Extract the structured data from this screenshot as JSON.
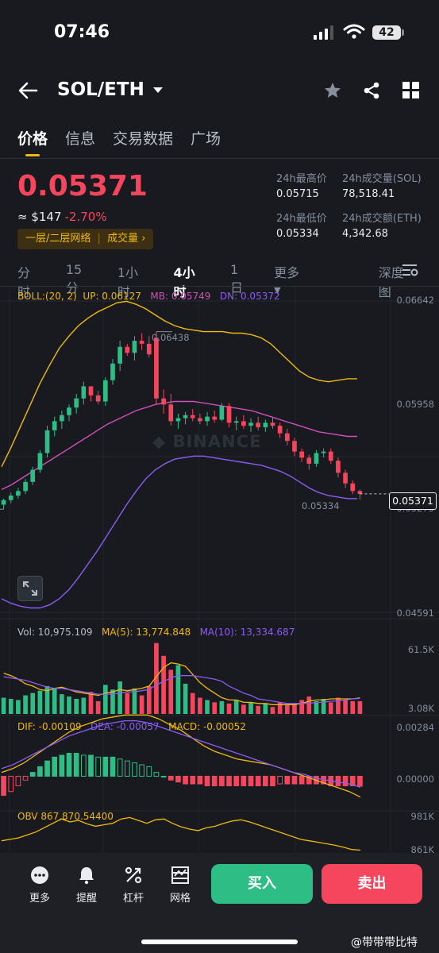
{
  "status_bar": {
    "time": "07:46",
    "battery": "42"
  },
  "header": {
    "pair": "SOL/ETH"
  },
  "tabs": [
    {
      "label": "价格",
      "active": true
    },
    {
      "label": "信息",
      "active": false
    },
    {
      "label": "交易数据",
      "active": false
    },
    {
      "label": "广场",
      "active": false
    }
  ],
  "ticker": {
    "last_price": "0.05371",
    "approx_usd": "≈ $147",
    "change_pct": "-2.70%",
    "network_badge": "一层/二层网络",
    "volume_link": "成交量",
    "high_label": "24h最高价",
    "high_value": "0.05715",
    "low_label": "24h最低价",
    "low_value": "0.05334",
    "vol_sol_label": "24h成交量(SOL)",
    "vol_sol_value": "78,518.41",
    "vol_eth_label": "24h成交额(ETH)",
    "vol_eth_value": "4,342.68"
  },
  "intervals": [
    {
      "label": "分时",
      "active": false
    },
    {
      "label": "15分",
      "active": false
    },
    {
      "label": "1小时",
      "active": false
    },
    {
      "label": "4小时",
      "active": true
    },
    {
      "label": "1日",
      "active": false
    },
    {
      "label": "更多",
      "active": false
    },
    {
      "label": "深度图",
      "active": false
    }
  ],
  "boll": {
    "label": "BOLL:(20, 2)",
    "up": "UP: 0.06127",
    "mb": "MB: 0.05749",
    "dn": "DN: 0.05372"
  },
  "main_axis": {
    "top": "0.06642",
    "mid": "0.05958",
    "low": "0.05275",
    "bottom": "0.04591"
  },
  "annotations": {
    "high_marker": "0.06438",
    "low_marker": "0.05334",
    "current_price_tag": "0.05371",
    "watermark": "BINANCE"
  },
  "volume_panel": {
    "vol": "Vol: 10,975.109",
    "ma5": "MA(5): 13,774.848",
    "ma10": "MA(10): 13,334.687",
    "axis_top": "61.5K",
    "axis_bottom": "3.08K"
  },
  "macd_panel": {
    "dif": "DIF: -0.00109",
    "dea": "DEA: -0.00057",
    "macd": "MACD: -0.00052",
    "axis_top": "0.00284",
    "axis_zero": "0.00000"
  },
  "obv_panel": {
    "obv": "OBV 867,870.54400",
    "axis_top": "981K",
    "axis_bottom": "861K"
  },
  "toolbar": [
    {
      "label": "更多",
      "icon": "more-icon"
    },
    {
      "label": "提醒",
      "icon": "bell-icon"
    },
    {
      "label": "杠杆",
      "icon": "leverage-icon"
    },
    {
      "label": "网格",
      "icon": "grid-bot-icon"
    }
  ],
  "actions": {
    "buy": "买入",
    "sell": "卖出"
  },
  "footer": {
    "watermark": "@带带带比特"
  },
  "colors": {
    "up": "#2ebd85",
    "down": "#f6465d",
    "accent": "#f0b90b",
    "boll_up": "#f0b90b",
    "boll_mb": "#d04fbb",
    "boll_dn": "#8b5cf6"
  },
  "chart_data": {
    "type": "candlestick",
    "interval": "4小时",
    "ylim": [
      0.04591,
      0.06642
    ],
    "candles": [
      {
        "o": 0.053,
        "h": 0.0534,
        "l": 0.0527,
        "c": 0.0533
      },
      {
        "o": 0.0533,
        "h": 0.0538,
        "l": 0.0531,
        "c": 0.0536
      },
      {
        "o": 0.0536,
        "h": 0.0541,
        "l": 0.0534,
        "c": 0.0539
      },
      {
        "o": 0.0539,
        "h": 0.0547,
        "l": 0.0537,
        "c": 0.0545
      },
      {
        "o": 0.0545,
        "h": 0.0555,
        "l": 0.0543,
        "c": 0.0553
      },
      {
        "o": 0.0553,
        "h": 0.0566,
        "l": 0.0551,
        "c": 0.0564
      },
      {
        "o": 0.0564,
        "h": 0.0582,
        "l": 0.0561,
        "c": 0.0579
      },
      {
        "o": 0.0579,
        "h": 0.0588,
        "l": 0.0575,
        "c": 0.0585
      },
      {
        "o": 0.0585,
        "h": 0.0592,
        "l": 0.058,
        "c": 0.0589
      },
      {
        "o": 0.0589,
        "h": 0.0596,
        "l": 0.0585,
        "c": 0.0594
      },
      {
        "o": 0.0594,
        "h": 0.0603,
        "l": 0.059,
        "c": 0.06
      },
      {
        "o": 0.06,
        "h": 0.0611,
        "l": 0.0596,
        "c": 0.0608
      },
      {
        "o": 0.0608,
        "h": 0.0608,
        "l": 0.0598,
        "c": 0.0602
      },
      {
        "o": 0.0602,
        "h": 0.0605,
        "l": 0.0596,
        "c": 0.0598
      },
      {
        "o": 0.0598,
        "h": 0.0614,
        "l": 0.0595,
        "c": 0.0612
      },
      {
        "o": 0.0612,
        "h": 0.0626,
        "l": 0.0609,
        "c": 0.0623
      },
      {
        "o": 0.0623,
        "h": 0.0638,
        "l": 0.0618,
        "c": 0.0634
      },
      {
        "o": 0.0634,
        "h": 0.0636,
        "l": 0.0628,
        "c": 0.063
      },
      {
        "o": 0.063,
        "h": 0.0641,
        "l": 0.0625,
        "c": 0.0638
      },
      {
        "o": 0.0638,
        "h": 0.0643,
        "l": 0.0632,
        "c": 0.0636
      },
      {
        "o": 0.0636,
        "h": 0.0641,
        "l": 0.0627,
        "c": 0.0629
      },
      {
        "o": 0.064,
        "h": 0.0644,
        "l": 0.0596,
        "c": 0.06
      },
      {
        "o": 0.06,
        "h": 0.0606,
        "l": 0.059,
        "c": 0.0596
      },
      {
        "o": 0.0596,
        "h": 0.0603,
        "l": 0.0582,
        "c": 0.0585
      },
      {
        "o": 0.0585,
        "h": 0.059,
        "l": 0.058,
        "c": 0.0587
      },
      {
        "o": 0.0587,
        "h": 0.0591,
        "l": 0.0583,
        "c": 0.0589
      },
      {
        "o": 0.0589,
        "h": 0.0593,
        "l": 0.0585,
        "c": 0.0587
      },
      {
        "o": 0.0587,
        "h": 0.059,
        "l": 0.0583,
        "c": 0.0585
      },
      {
        "o": 0.0585,
        "h": 0.0591,
        "l": 0.0582,
        "c": 0.0588
      },
      {
        "o": 0.0588,
        "h": 0.0592,
        "l": 0.0584,
        "c": 0.0586
      },
      {
        "o": 0.0586,
        "h": 0.0597,
        "l": 0.0585,
        "c": 0.0595
      },
      {
        "o": 0.0595,
        "h": 0.0597,
        "l": 0.0581,
        "c": 0.0584
      },
      {
        "o": 0.0584,
        "h": 0.0588,
        "l": 0.0579,
        "c": 0.0585
      },
      {
        "o": 0.0585,
        "h": 0.0589,
        "l": 0.058,
        "c": 0.0582
      },
      {
        "o": 0.0582,
        "h": 0.0587,
        "l": 0.0578,
        "c": 0.0584
      },
      {
        "o": 0.0584,
        "h": 0.0588,
        "l": 0.0579,
        "c": 0.0581
      },
      {
        "o": 0.0581,
        "h": 0.0586,
        "l": 0.0578,
        "c": 0.0584
      },
      {
        "o": 0.0584,
        "h": 0.0588,
        "l": 0.058,
        "c": 0.0582
      },
      {
        "o": 0.0582,
        "h": 0.0584,
        "l": 0.0574,
        "c": 0.0577
      },
      {
        "o": 0.0577,
        "h": 0.058,
        "l": 0.0569,
        "c": 0.0572
      },
      {
        "o": 0.0572,
        "h": 0.0574,
        "l": 0.0562,
        "c": 0.0565
      },
      {
        "o": 0.0565,
        "h": 0.0567,
        "l": 0.0558,
        "c": 0.0561
      },
      {
        "o": 0.0561,
        "h": 0.0563,
        "l": 0.0553,
        "c": 0.0557
      },
      {
        "o": 0.0557,
        "h": 0.0566,
        "l": 0.0555,
        "c": 0.0564
      },
      {
        "o": 0.0564,
        "h": 0.0567,
        "l": 0.0561,
        "c": 0.0565
      },
      {
        "o": 0.0565,
        "h": 0.0567,
        "l": 0.0557,
        "c": 0.0559
      },
      {
        "o": 0.0559,
        "h": 0.0561,
        "l": 0.0548,
        "c": 0.0551
      },
      {
        "o": 0.0551,
        "h": 0.0553,
        "l": 0.0541,
        "c": 0.0544
      },
      {
        "o": 0.0544,
        "h": 0.0546,
        "l": 0.0537,
        "c": 0.0539
      },
      {
        "o": 0.0539,
        "h": 0.054,
        "l": 0.05334,
        "c": 0.05371
      }
    ],
    "boll_up": [
      0.0555,
      0.0568,
      0.0582,
      0.0596,
      0.061,
      0.0622,
      0.0633,
      0.0641,
      0.0648,
      0.0653,
      0.0657,
      0.066,
      0.0663,
      0.0664,
      0.0662,
      0.0659,
      0.0655,
      0.0651,
      0.0648,
      0.0646,
      0.0645,
      0.0644,
      0.0644,
      0.0644,
      0.0643,
      0.0643,
      0.0642,
      0.064,
      0.0636,
      0.063,
      0.0624,
      0.0618,
      0.0614,
      0.0612,
      0.0611,
      0.0612,
      0.0613,
      0.0613
    ],
    "boll_mb": [
      0.054,
      0.0543,
      0.0547,
      0.0551,
      0.0555,
      0.0559,
      0.0563,
      0.0567,
      0.0571,
      0.0575,
      0.0579,
      0.0583,
      0.0586,
      0.0589,
      0.0592,
      0.0594,
      0.0596,
      0.0597,
      0.0598,
      0.0598,
      0.0598,
      0.0597,
      0.0596,
      0.0595,
      0.0594,
      0.0593,
      0.0592,
      0.059,
      0.0588,
      0.0586,
      0.0584,
      0.0582,
      0.058,
      0.0578,
      0.0577,
      0.0576,
      0.0575,
      0.0575
    ],
    "boll_dn": [
      0.0468,
      0.0465,
      0.0463,
      0.0462,
      0.0462,
      0.0464,
      0.0468,
      0.0474,
      0.0482,
      0.0491,
      0.05,
      0.051,
      0.052,
      0.053,
      0.0539,
      0.0547,
      0.0553,
      0.0557,
      0.056,
      0.0561,
      0.0562,
      0.0562,
      0.0561,
      0.056,
      0.0559,
      0.0558,
      0.0557,
      0.0556,
      0.0554,
      0.0552,
      0.0549,
      0.0545,
      0.0541,
      0.0538,
      0.0536,
      0.0535,
      0.0534,
      0.0534
    ],
    "volumes": [
      14,
      13,
      12,
      16,
      18,
      20,
      24,
      22,
      17,
      15,
      13,
      14,
      19,
      11,
      25,
      21,
      28,
      18,
      22,
      16,
      24,
      61,
      50,
      38,
      42,
      26,
      18,
      14,
      12,
      10,
      11,
      9,
      12,
      8,
      10,
      7,
      9,
      6,
      10,
      8,
      9,
      12,
      15,
      11,
      13,
      10,
      14,
      12,
      11,
      10.98
    ],
    "vol_ylim": [
      3.08,
      61.5
    ],
    "ma5": [
      35,
      33,
      30,
      26,
      24,
      21,
      20,
      22,
      23,
      21,
      19,
      18,
      17,
      16,
      18,
      19,
      21,
      20,
      21,
      22,
      24,
      32,
      40,
      44,
      43,
      41,
      34,
      27,
      22,
      18,
      14,
      12,
      12,
      10,
      10,
      9,
      9,
      8,
      8,
      8,
      8,
      9,
      11,
      12,
      12,
      13,
      13,
      13,
      13,
      13.77
    ],
    "ma10": [
      32,
      31,
      30,
      29,
      27,
      25,
      23,
      22,
      22,
      21,
      20,
      19,
      18,
      17,
      17,
      17,
      18,
      19,
      19,
      20,
      21,
      25,
      28,
      31,
      33,
      33,
      33,
      32,
      31,
      30,
      28,
      24,
      21,
      18,
      16,
      13,
      12,
      11,
      10,
      9,
      9,
      9,
      9,
      10,
      10,
      11,
      11,
      12,
      13,
      13.33
    ],
    "macd_hist": [
      -0.001,
      -0.0008,
      -0.0005,
      -0.0002,
      0.0002,
      0.0005,
      0.0008,
      0.001,
      0.0011,
      0.0012,
      0.0012,
      0.0011,
      0.0011,
      0.001,
      0.001,
      0.001,
      0.0009,
      0.0008,
      0.0007,
      0.0006,
      0.0005,
      0.0002,
      0.0,
      -0.0002,
      -0.0003,
      -0.0004,
      -0.0004,
      -0.0004,
      -0.0005,
      -0.0005,
      -0.0005,
      -0.0005,
      -0.0005,
      -0.0005,
      -0.0005,
      -0.0005,
      -0.0005,
      -0.0005,
      -0.0004,
      -0.0004,
      -0.0004,
      -0.0004,
      -0.0004,
      -0.0004,
      -0.0004,
      -0.0005,
      -0.0005,
      -0.0005,
      -0.0005,
      -0.00052
    ],
    "dif": [
      0.0002,
      0.0004,
      0.0007,
      0.0011,
      0.0015,
      0.0019,
      0.0023,
      0.0026,
      0.0028,
      0.003,
      0.0031,
      0.0032,
      0.0032,
      0.0032,
      0.003,
      0.0027,
      0.0024,
      0.002,
      0.0016,
      0.0013,
      0.0011,
      0.0009,
      0.0008,
      0.0007,
      0.0006,
      0.0004,
      0.0002,
      0.0,
      -0.0002,
      -0.0004,
      -0.0006,
      -0.0008,
      -0.00109
    ],
    "dea": [
      0.0004,
      0.0006,
      0.0009,
      0.0012,
      0.0015,
      0.0018,
      0.0021,
      0.0023,
      0.0025,
      0.0027,
      0.0028,
      0.0029,
      0.0029,
      0.0028,
      0.0026,
      0.0024,
      0.0022,
      0.002,
      0.0018,
      0.0016,
      0.0014,
      0.0012,
      0.001,
      0.0008,
      0.0006,
      0.0004,
      0.0002,
      0.0001,
      -0.0001,
      -0.0002,
      -0.0003,
      -0.0004,
      -0.00057
    ],
    "macd_ylim": [
      -0.0016,
      0.00284
    ],
    "obv": [
      900,
      905,
      910,
      920,
      930,
      945,
      960,
      975,
      965,
      970,
      958,
      950,
      955,
      960,
      975,
      980,
      970,
      960,
      972,
      975,
      960,
      948,
      940,
      935,
      945,
      950,
      960,
      968,
      972,
      965,
      955,
      945,
      935,
      925,
      915,
      905,
      900,
      895,
      890,
      885,
      878,
      870,
      867.87
    ],
    "obv_ylim": [
      861,
      981
    ]
  }
}
